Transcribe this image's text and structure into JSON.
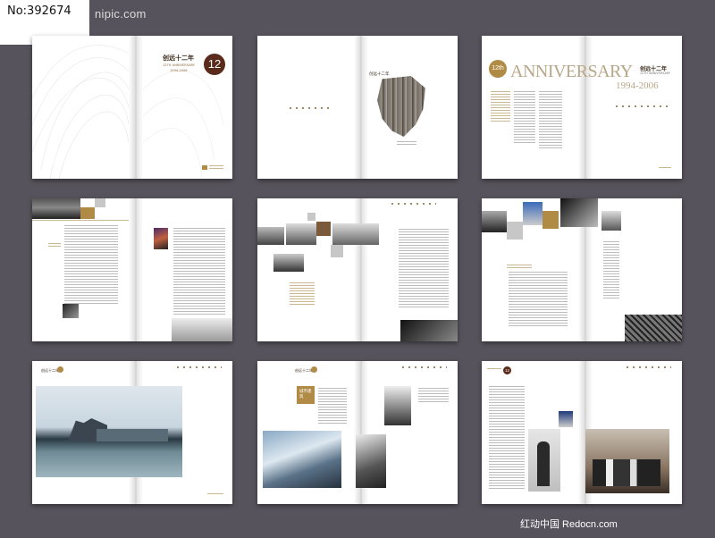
{
  "tag": {
    "id_label": "No:392674"
  },
  "watermark": {
    "top": "nipic.com"
  },
  "footer": {
    "label": "红动中国 Redocn.com"
  },
  "spread1": {
    "cn_title": "创远十二年",
    "en_sub": "12TH ANNIVERSARY",
    "years": "1994-2006",
    "badge": "12"
  },
  "spread2": {
    "cn_title": "创远十二年"
  },
  "spread3": {
    "badge": "12th",
    "headline": "ANNIVERSARY",
    "cn_title": "创远十二年",
    "en_sub": "12TH ANNIVERSARY",
    "years": "1994-2006"
  },
  "spread7": {
    "cn_title": "创远十二年"
  },
  "spread8": {
    "cn_title": "创远十二年",
    "label_box": "城市建筑"
  },
  "spread9": {
    "badge": "12"
  },
  "colors": {
    "background": "#57535c",
    "accent_gold": "#b08b45",
    "badge_dark": "#5a2a1a"
  }
}
